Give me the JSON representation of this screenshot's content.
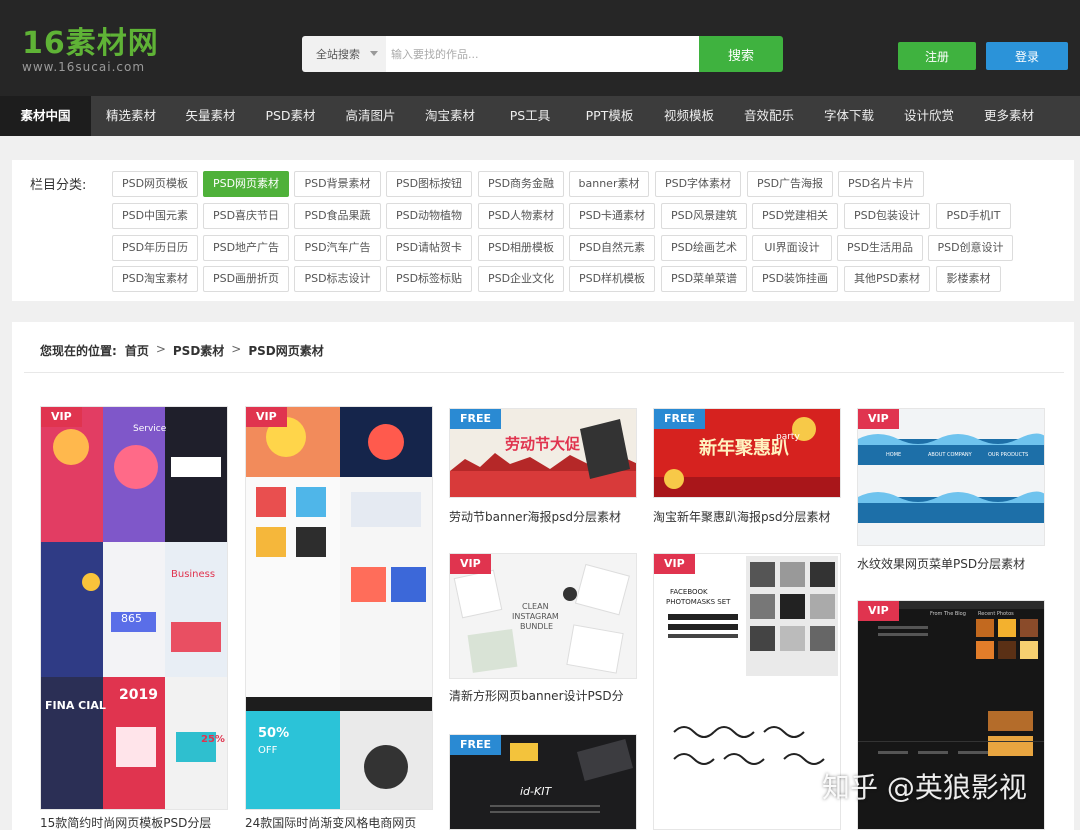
{
  "header": {
    "logo_main": "16素材网",
    "logo_sub": "www.16sucai.com",
    "search_scope": "全站搜索",
    "search_placeholder": "输入要找的作品...",
    "search_button": "搜索",
    "register": "注册",
    "login": "登录"
  },
  "nav": [
    {
      "label": "素材中国",
      "active": true
    },
    {
      "label": "精选素材"
    },
    {
      "label": "矢量素材"
    },
    {
      "label": "PSD素材"
    },
    {
      "label": "高清图片"
    },
    {
      "label": "淘宝素材"
    },
    {
      "label": "PS工具"
    },
    {
      "label": "PPT模板"
    },
    {
      "label": "视频模板"
    },
    {
      "label": "音效配乐"
    },
    {
      "label": "字体下载"
    },
    {
      "label": "设计欣赏"
    },
    {
      "label": "更多素材"
    }
  ],
  "categories": {
    "label": "栏目分类:",
    "rows": [
      [
        "PSD网页模板",
        "PSD网页素材",
        "PSD背景素材",
        "PSD图标按钮",
        "PSD商务金融",
        "banner素材",
        "PSD字体素材",
        "PSD广告海报",
        "PSD名片卡片"
      ],
      [
        "PSD中国元素",
        "PSD喜庆节日",
        "PSD食品果蔬",
        "PSD动物植物",
        "PSD人物素材",
        "PSD卡通素材",
        "PSD风景建筑",
        "PSD党建相关",
        "PSD包装设计",
        "PSD手机IT"
      ],
      [
        "PSD年历日历",
        "PSD地产广告",
        "PSD汽车广告",
        "PSD请帖贺卡",
        "PSD相册模板",
        "PSD自然元素",
        "PSD绘画艺术",
        "UI界面设计",
        "PSD生活用品",
        "PSD创意设计"
      ],
      [
        "PSD淘宝素材",
        "PSD画册折页",
        "PSD标志设计",
        "PSD标签标贴",
        "PSD企业文化",
        "PSD样机模板",
        "PSD菜单菜谱",
        "PSD装饰挂画",
        "其他PSD素材",
        "影楼素材"
      ]
    ],
    "active": "PSD网页素材"
  },
  "breadcrumb": {
    "prefix": "您现在的位置:",
    "items": [
      "首页",
      "PSD素材",
      "PSD网页素材"
    ],
    "separator": ">"
  },
  "cards": [
    {
      "badge": "VIP",
      "title": "15款简约时尚网页模板PSD分层"
    },
    {
      "badge": "VIP",
      "title": "24款国际时尚渐变风格电商网页"
    },
    {
      "badge": "FREE",
      "title": "劳动节banner海报psd分层素材"
    },
    {
      "badge": "FREE",
      "title": "淘宝新年聚惠趴海报psd分层素材"
    },
    {
      "badge": "VIP",
      "title": "水纹效果网页菜单PSD分层素材"
    },
    {
      "badge": "VIP",
      "title": "清新方形网页banner设计PSD分"
    },
    {
      "badge": "VIP",
      "title": ""
    },
    {
      "badge": "FREE",
      "title": ""
    },
    {
      "badge": "VIP",
      "title": ""
    }
  ],
  "thumb_texts": {
    "labor_day": "劳动节大促",
    "newyear_main": "新年聚惠趴",
    "newyear_party": "party",
    "clean_lines": [
      "CLEAN",
      "INSTAGRAM",
      "BUNDLE"
    ],
    "facebook_lines": [
      "FACEBOOK",
      "PHOTOMASKS SET"
    ],
    "idkit": "id-KIT",
    "sale_2019": "2019",
    "fifty_off": "50%",
    "fifty_off_sub": "OFF",
    "financial": "FINA CIAL",
    "service": "Service",
    "business": "Business",
    "num_865": "865",
    "pct_25": "25%",
    "water_menu": [
      "HOME",
      "ABOUT COMPANY",
      "OUR PRODUCTS"
    ],
    "blog_head": [
      "From The Blog",
      "Recent Photos"
    ]
  },
  "watermark": "知乎 @英狼影视",
  "colors": {
    "header_bg": "#262626",
    "nav_bg": "#3c3c3c",
    "nav_active": "#1d1d1d",
    "accent_green": "#3fb23f",
    "login_blue": "#2b93d9",
    "vip_red": "#e0344f",
    "free_blue": "#2a8ad3"
  }
}
